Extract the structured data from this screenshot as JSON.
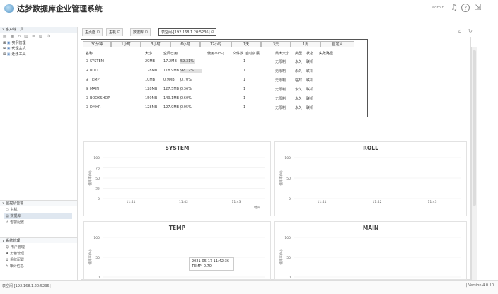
{
  "app": {
    "title": "达梦数据库企业管理系统",
    "user": "admin"
  },
  "left": {
    "client_tools_header": "客户端工具",
    "toolbar_icons": [
      "refresh-icon",
      "grid-icon",
      "home-icon",
      "chart-icon",
      "list-icon",
      "db-icon",
      "gear-icon"
    ],
    "tree": [
      {
        "label": "实例管理",
        "icon": "instance-icon"
      },
      {
        "label": "代理主机",
        "icon": "host-icon"
      },
      {
        "label": "迁移工具",
        "icon": "migrate-icon"
      }
    ],
    "monitor_section": "监控及告警",
    "monitor_items": [
      "主机",
      "数据库",
      "告警配置"
    ],
    "system_section": "系统管理",
    "system_items": [
      "用户管理",
      "角色管理",
      "系统配置",
      "审计信息"
    ]
  },
  "tabs": [
    {
      "label": "主页面 ⊡"
    },
    {
      "label": "主机 ⊡"
    },
    {
      "label": "数据库 ⊡"
    },
    {
      "label": "表空间-[192.168.1.20:5236] ⊡"
    }
  ],
  "popup": {
    "ranges": [
      "30分钟",
      "1小时",
      "3小时",
      "6小时",
      "12小时",
      "1天",
      "3天",
      "1周",
      "自定义"
    ],
    "columns": [
      "名称",
      "大小",
      "空间已用",
      "使用率(%)",
      "文件数",
      "自动扩展",
      "最大大小",
      "类型",
      "状态",
      "失败路径"
    ],
    "rows": [
      {
        "name": "SYSTEM",
        "size": "29MB",
        "used": "17.2MB",
        "pct": "59.31%",
        "files": "1",
        "max": "无限制",
        "type": "永久",
        "state": "联机"
      },
      {
        "name": "ROLL",
        "size": "128MB",
        "used": "118.9MB",
        "pct": "92.12%",
        "files": "1",
        "max": "无限制",
        "type": "永久",
        "state": "联机"
      },
      {
        "name": "TEMP",
        "size": "10MB",
        "used": "0.9MB",
        "pct": "0.70%",
        "files": "1",
        "max": "无限制",
        "type": "临时",
        "state": "联机"
      },
      {
        "name": "MAIN",
        "size": "128MB",
        "used": "127.5MB",
        "pct": "0.36%",
        "files": "1",
        "max": "无限制",
        "type": "永久",
        "state": "联机"
      },
      {
        "name": "BOOKSHOP",
        "size": "150MB",
        "used": "149.1MB",
        "pct": "0.60%",
        "files": "1",
        "max": "无限制",
        "type": "永久",
        "state": "联机"
      },
      {
        "name": "DMHR",
        "size": "128MB",
        "used": "127.9MB",
        "pct": "0.05%",
        "files": "1",
        "max": "无限制",
        "type": "永久",
        "state": "联机"
      }
    ]
  },
  "chart_data": [
    {
      "type": "line",
      "title": "SYSTEM",
      "ylabel": "使用率(%)",
      "xlabel": "时间",
      "yticks": [
        "100",
        "75",
        "50",
        "25",
        "0"
      ],
      "xticks": [
        "11:41",
        "11:42",
        "11:43"
      ],
      "series": [
        {
          "values": []
        }
      ]
    },
    {
      "type": "line",
      "title": "ROLL",
      "ylabel": "使用率(%)",
      "xlabel": "",
      "yticks": [
        "100",
        "50",
        "0"
      ],
      "xticks": [
        "11:41",
        "11:42",
        "11:43"
      ],
      "series": [
        {
          "values": []
        }
      ]
    },
    {
      "type": "line",
      "title": "TEMP",
      "ylabel": "使用率(%)",
      "xlabel": "",
      "yticks": [
        "100",
        "50",
        "0"
      ],
      "xticks": [],
      "series": [
        {
          "values": []
        }
      ]
    },
    {
      "type": "line",
      "title": "MAIN",
      "ylabel": "使用率(%)",
      "xlabel": "",
      "yticks": [
        "100",
        "50",
        "0"
      ],
      "xticks": [],
      "series": [
        {
          "values": []
        }
      ]
    }
  ],
  "tooltip": {
    "line1": "2021-05-17 11:42:36",
    "line2": "TEMP: 0.70"
  },
  "status": {
    "left": "表空间-[192.168.1.20:5236]",
    "right": "| Version 4.0.10"
  },
  "colors": {
    "bar": "#e0e0e0",
    "grid": "#e9e9e9"
  }
}
